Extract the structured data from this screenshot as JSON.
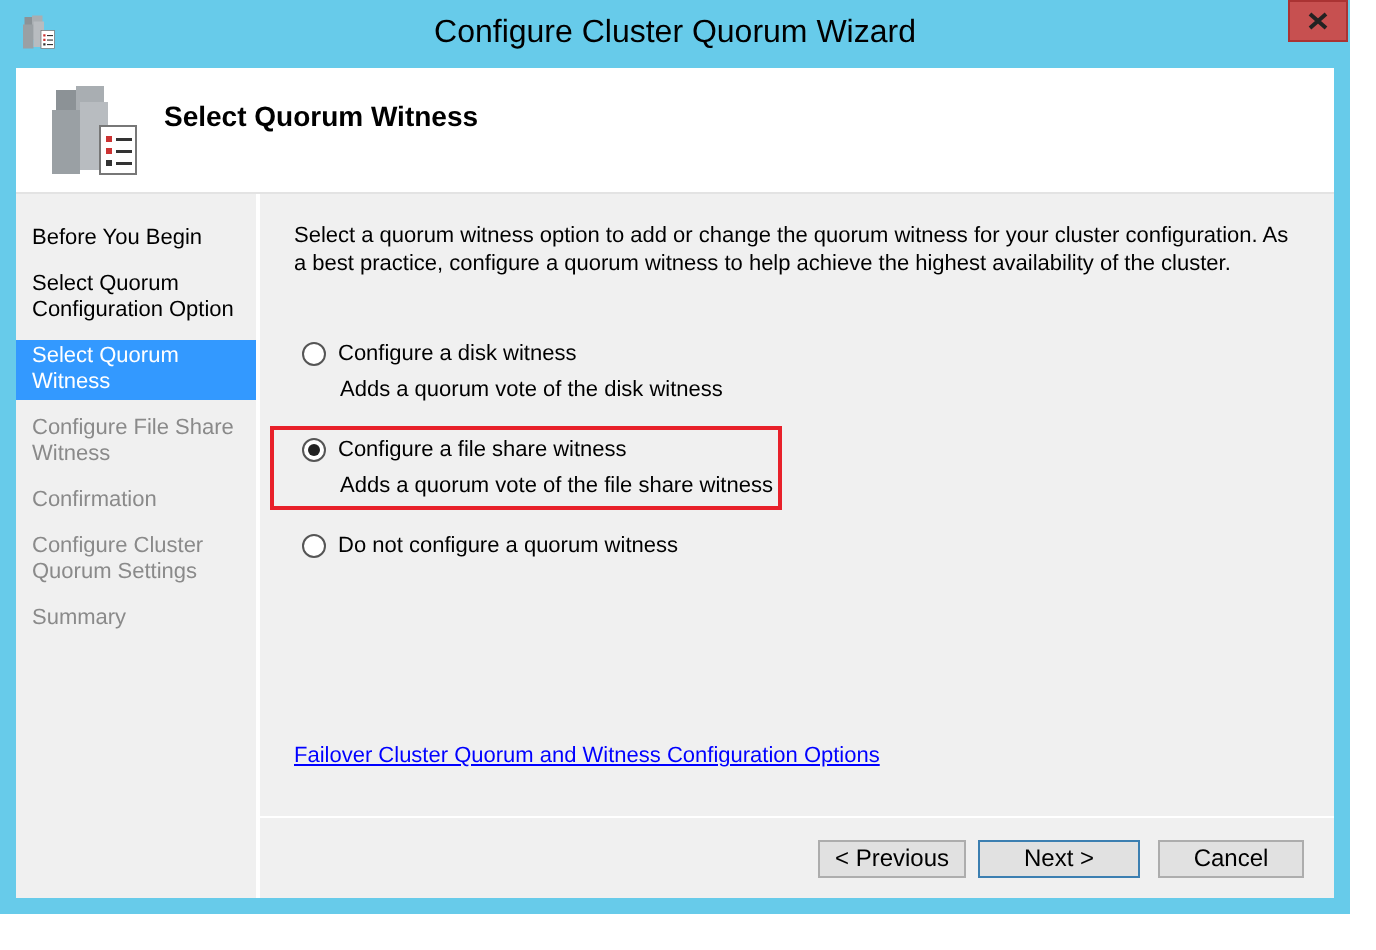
{
  "window": {
    "title": "Configure Cluster Quorum Wizard"
  },
  "header": {
    "title": "Select Quorum Witness"
  },
  "steps": [
    {
      "label": "Before You Begin",
      "selected": false,
      "disabled": false
    },
    {
      "label": "Select Quorum Configuration Option",
      "selected": false,
      "disabled": false
    },
    {
      "label": "Select Quorum Witness",
      "selected": true,
      "disabled": false
    },
    {
      "label": "Configure File Share Witness",
      "selected": false,
      "disabled": true
    },
    {
      "label": "Confirmation",
      "selected": false,
      "disabled": true
    },
    {
      "label": "Configure Cluster Quorum Settings",
      "selected": false,
      "disabled": true
    },
    {
      "label": "Summary",
      "selected": false,
      "disabled": true
    }
  ],
  "description": "Select a quorum witness option to add or change the quorum witness for your cluster configuration. As a best practice, configure a quorum witness to help achieve the highest availability of the cluster.",
  "options": [
    {
      "label": "Configure a disk witness",
      "hint": "Adds a quorum vote of the disk witness",
      "selected": false,
      "highlighted": false
    },
    {
      "label": "Configure a file share witness",
      "hint": "Adds a quorum vote of the file share witness",
      "selected": true,
      "highlighted": true
    },
    {
      "label": "Do not configure a quorum witness",
      "selected": false,
      "highlighted": false
    }
  ],
  "help_link": "Failover Cluster Quorum and Witness Configuration Options",
  "buttons": [
    {
      "label": "< Previous",
      "default": false
    },
    {
      "label": "Next >",
      "default": true
    },
    {
      "label": "Cancel",
      "default": false
    }
  ]
}
